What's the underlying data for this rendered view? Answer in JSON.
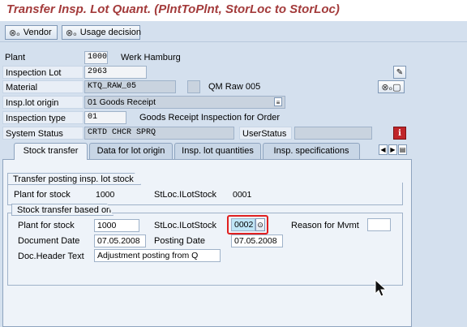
{
  "window": {
    "title": "Transfer Insp. Lot Quant. (PlntToPlnt, StorLoc to StorLoc)"
  },
  "toolbar": {
    "vendor_label": "Vendor",
    "usage_decision_label": "Usage decision"
  },
  "header": {
    "plant": {
      "label": "Plant",
      "value": "1000",
      "text": "Werk Hamburg"
    },
    "inspection_lot": {
      "label": "Inspection Lot",
      "value": "2963"
    },
    "material": {
      "label": "Material",
      "value": "KTQ_RAW_05",
      "text": "QM Raw 005"
    },
    "insp_lot_origin": {
      "label": "Insp.lot origin",
      "value": "01 Goods Receipt"
    },
    "inspection_type": {
      "label": "Inspection type",
      "value": "01",
      "text": "Goods Receipt Inspection for Order"
    },
    "system_status": {
      "label": "System Status",
      "value": "CRTD CHCR SPRQ",
      "user_status_label": "UserStatus",
      "user_status_value": ""
    }
  },
  "tabs": [
    {
      "label": "Stock transfer",
      "active": true
    },
    {
      "label": "Data for lot origin",
      "active": false
    },
    {
      "label": "Insp. lot quantities",
      "active": false
    },
    {
      "label": "Insp. specifications",
      "active": false
    }
  ],
  "transfer_posting": {
    "title": "Transfer posting insp. lot stock",
    "plant_label": "Plant for stock",
    "plant_value": "1000",
    "sloc_label": "StLoc.ILotStock",
    "sloc_value": "0001"
  },
  "stock_transfer": {
    "title": "Stock transfer based on",
    "plant_label": "Plant for stock",
    "plant_value": "1000",
    "sloc_label": "StLoc.ILotStock",
    "sloc_value": "0002",
    "reason_label": "Reason for Mvmt",
    "reason_value": "",
    "doc_date_label": "Document Date",
    "doc_date_value": "07.05.2008",
    "posting_date_label": "Posting Date",
    "posting_date_value": "07.05.2008",
    "header_text_label": "Doc.Header Text",
    "header_text_value": "Adjustment posting from Q"
  },
  "icons": {
    "vendor": "glasses-icon",
    "usage_decision": "glasses-icon",
    "edit": "pencil-icon",
    "display": "glasses-icon",
    "info": "info-icon",
    "dropdown": "dropdown-icon",
    "f4_help": "search-help-icon"
  },
  "colors": {
    "title": "#a33b3b",
    "highlight": "#e02020",
    "info_button": "#c0262a"
  }
}
